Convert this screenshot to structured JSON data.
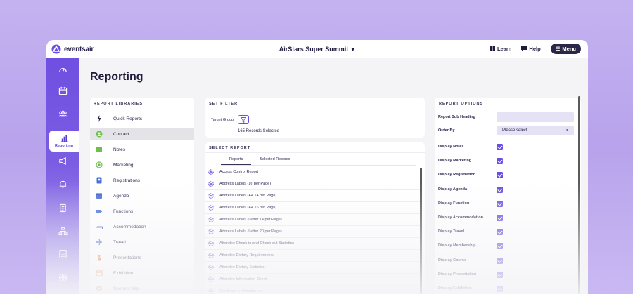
{
  "app": {
    "logo_text": "eventsair",
    "event_title": "AirStars Super Summit",
    "learn_label": "Learn",
    "help_label": "Help",
    "menu_label": "Menu"
  },
  "sidebar": {
    "active_label": "Reporting",
    "items": [
      "gauge-icon",
      "calendar-icon",
      "people-icon",
      "reporting-icon",
      "megaphone-icon",
      "bell-icon",
      "document-icon",
      "org-chart-icon",
      "list-icon",
      "globe-icon"
    ]
  },
  "page": {
    "title": "Reporting"
  },
  "libraries": {
    "heading": "REPORT LIBRARIES",
    "selected": "Contact",
    "items": [
      {
        "label": "Quick Reports",
        "icon": "bolt-icon",
        "color": "#2a2550"
      },
      {
        "label": "Contact",
        "icon": "contact-icon",
        "color": "#6cc04a"
      },
      {
        "label": "Notes",
        "icon": "note-icon",
        "color": "#6cc04a"
      },
      {
        "label": "Marketing",
        "icon": "target-icon",
        "color": "#6cc04a"
      },
      {
        "label": "Registrations",
        "icon": "badge-icon",
        "color": "#4a6fd8"
      },
      {
        "label": "Agenda",
        "icon": "calendar-icon",
        "color": "#4a6fd8"
      },
      {
        "label": "Functions",
        "icon": "cup-icon",
        "color": "#4a6fd8"
      },
      {
        "label": "Accommodation",
        "icon": "bed-icon",
        "color": "#4a6fd8"
      },
      {
        "label": "Travel",
        "icon": "plane-icon",
        "color": "#4a6fd8"
      },
      {
        "label": "Presentations",
        "icon": "presenter-icon",
        "color": "#e8824a"
      },
      {
        "label": "Exhibition",
        "icon": "booth-icon",
        "color": "#e8824a"
      },
      {
        "label": "Sponsorship",
        "icon": "sponsor-icon",
        "color": "#e8824a"
      }
    ]
  },
  "filter": {
    "heading": "SET FILTER",
    "target_group_label": "Target Group",
    "records_selected": "165 Records Selected"
  },
  "select_report": {
    "heading": "SELECT REPORT",
    "tabs": [
      "Reports",
      "Selected Records"
    ],
    "active_tab": "Reports",
    "rows": [
      "Access Control Report",
      "Address Labels (16 per Page)",
      "Address Labels (A4 14 per Page)",
      "Address Labels (A4 16 per Page)",
      "Address Labels (Letter 14 per Page)",
      "Address Labels (Letter 20 per Page)",
      "Attendee Check-in and Check-out Statistics",
      "Attendee Dietary Requirements",
      "Attendee Dietary Statistics",
      "Attendee Information Sheet",
      "Certificate of Attendance"
    ]
  },
  "options": {
    "heading": "REPORT OPTIONS",
    "sub_heading_label": "Report Sub Heading",
    "sub_heading_value": "",
    "order_by_label": "Order By",
    "order_by_value": "Please select...",
    "checkboxes": [
      {
        "label": "Display Notes",
        "checked": true
      },
      {
        "label": "Display Marketing",
        "checked": true
      },
      {
        "label": "Display Registration",
        "checked": true
      },
      {
        "label": "Display Agenda",
        "checked": true
      },
      {
        "label": "Display Function",
        "checked": true
      },
      {
        "label": "Display Accommodation",
        "checked": true
      },
      {
        "label": "Display Travel",
        "checked": true
      },
      {
        "label": "Display Membership",
        "checked": true
      },
      {
        "label": "Display Course",
        "checked": true
      },
      {
        "label": "Display Presentation",
        "checked": true
      },
      {
        "label": "Display Exhibition",
        "checked": true
      }
    ]
  },
  "colors": {
    "accent": "#6a4fe0",
    "sidebar": "#7355e2",
    "text": "#2a2550"
  }
}
